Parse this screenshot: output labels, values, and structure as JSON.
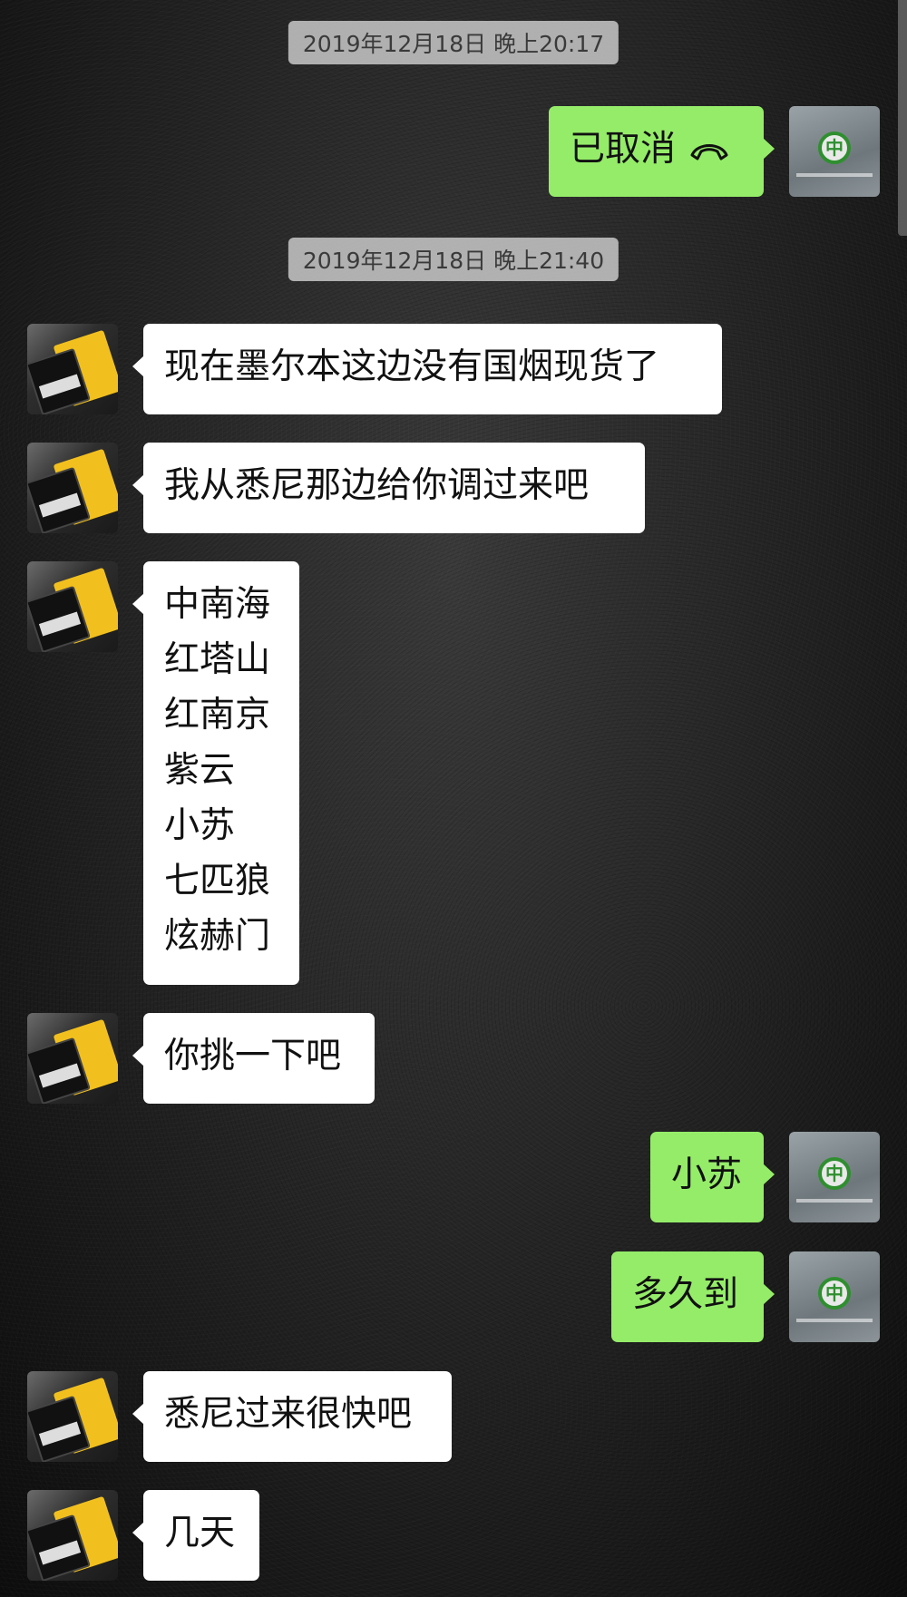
{
  "timestamps": [
    "2019年12月18日 晚上20:17",
    "2019年12月18日 晚上21:40"
  ],
  "messages": [
    {
      "side": "out",
      "text": "已取消",
      "icon": "hangup-phone-icon"
    },
    {
      "side": "in",
      "text": "现在墨尔本这边没有国烟现货了"
    },
    {
      "side": "in",
      "text": "我从悉尼那边给你调过来吧"
    },
    {
      "side": "in",
      "lines": [
        "中南海",
        "红塔山",
        "红南京",
        "紫云",
        "小苏",
        "七匹狼",
        "炫赫门"
      ]
    },
    {
      "side": "in",
      "text": "你挑一下吧"
    },
    {
      "side": "out",
      "text": "小苏"
    },
    {
      "side": "out",
      "text": "多久到"
    },
    {
      "side": "in",
      "text": "悉尼过来很快吧"
    },
    {
      "side": "in",
      "text": "几天"
    }
  ],
  "colors": {
    "outgoing_bubble": "#95ec69",
    "incoming_bubble": "#ffffff",
    "timestamp_bg": "#c8c8c8"
  }
}
